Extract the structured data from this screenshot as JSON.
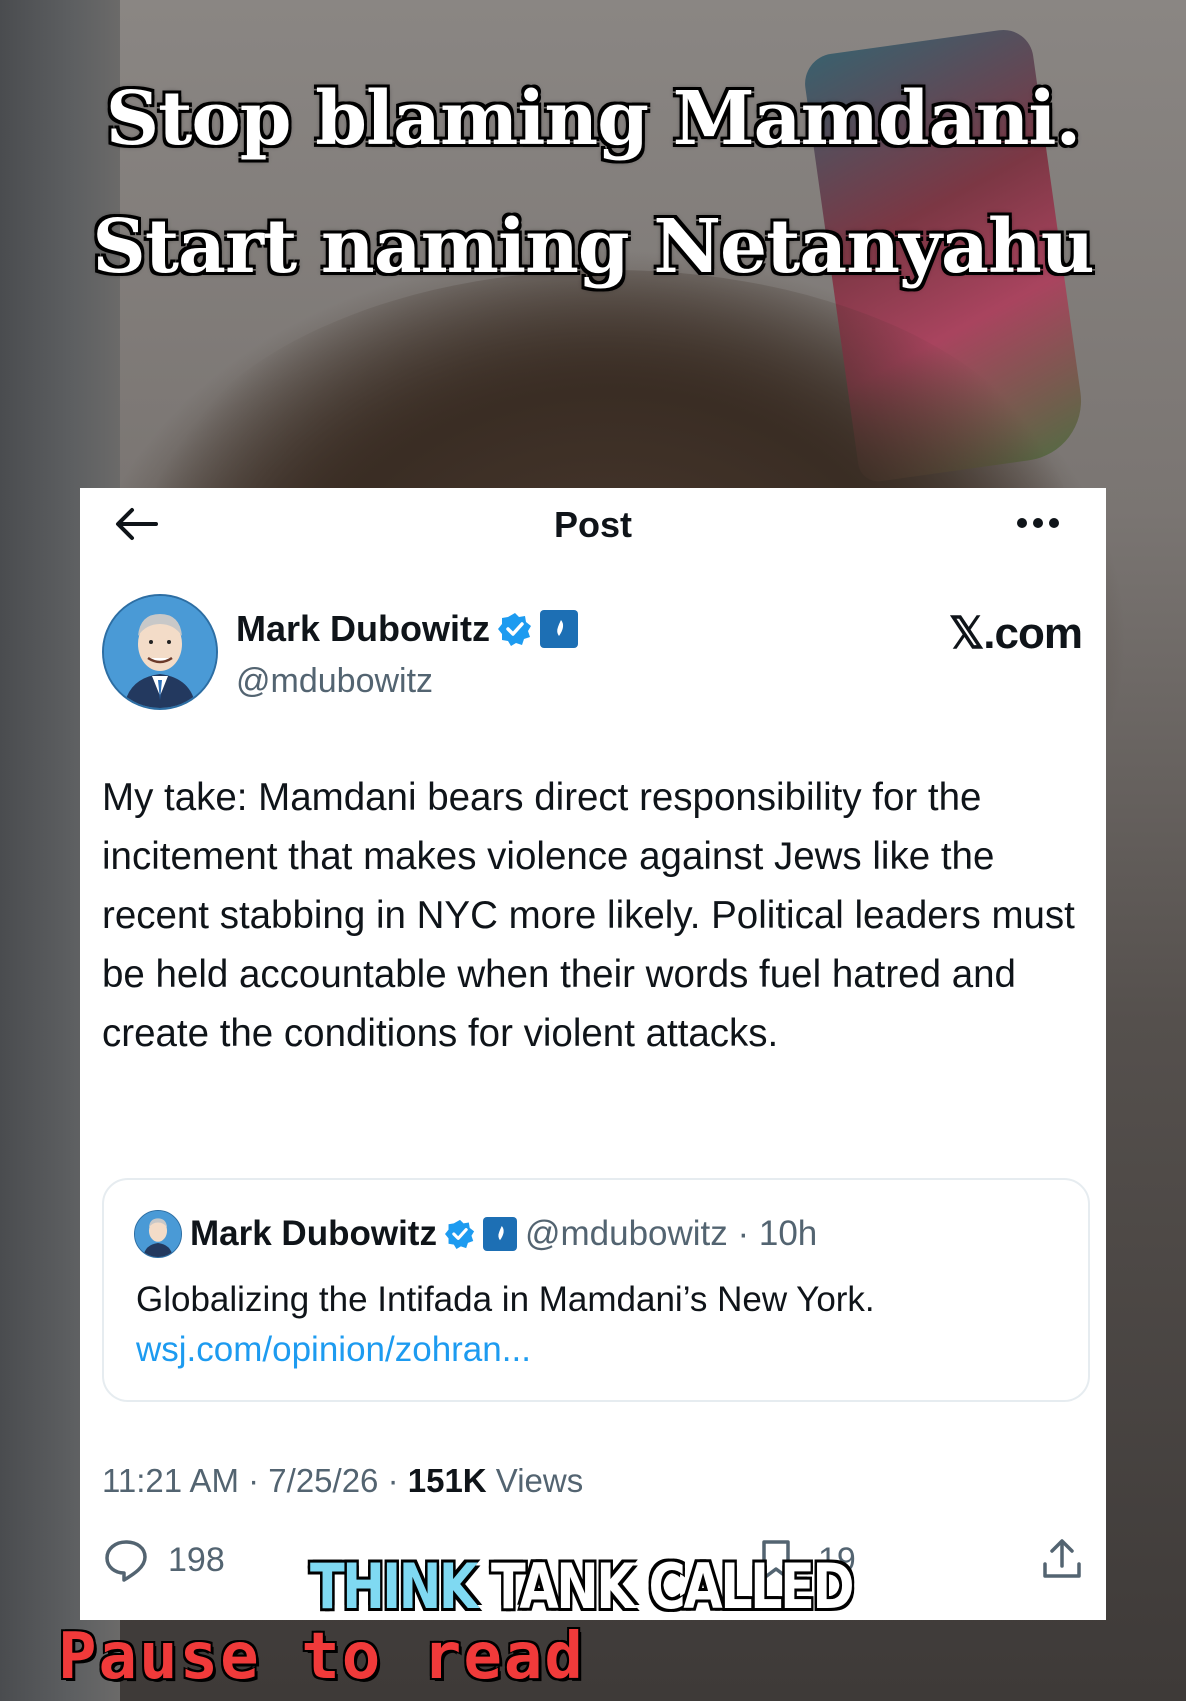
{
  "overlay": {
    "headline_line1": "Stop blaming Mamdani.",
    "headline_line2": "Start naming Netanyahu",
    "caption_part1": "THINK",
    "caption_part2": "TANK CALLED",
    "pause_label": "Pause to read"
  },
  "header": {
    "title": "Post",
    "back_icon": "arrow-left-icon",
    "more_icon": "more-horizontal-icon"
  },
  "post": {
    "author_name": "Mark Dubowitz",
    "handle": "@mdubowitz",
    "watermark": "𝕏.com",
    "text": "My take: Mamdani bears direct responsibility for the incitement that makes violence against Jews like the recent stabbing in NYC more likely. Political leaders must be held accountable when their words fuel hatred and create the conditions for violent attacks.",
    "time": "11:21 AM · 7/25/26 · ",
    "views_count": "151K",
    "views_label": " Views"
  },
  "quoted_post": {
    "author_name": "Mark Dubowitz",
    "handle_time": "@mdubowitz · 10h",
    "text": "Globalizing the Intifada in Mamdani’s New York.",
    "link": "wsj.com/opinion/zohran..."
  },
  "actions": {
    "replies": "198",
    "bookmarks": "19"
  },
  "colors": {
    "verified": "#1d9bf0",
    "affiliate_badge": "#1d6fb4",
    "link": "#1d9bf0",
    "caption_cyan": "#7fd9f2",
    "pause_red": "#f03a3a"
  }
}
